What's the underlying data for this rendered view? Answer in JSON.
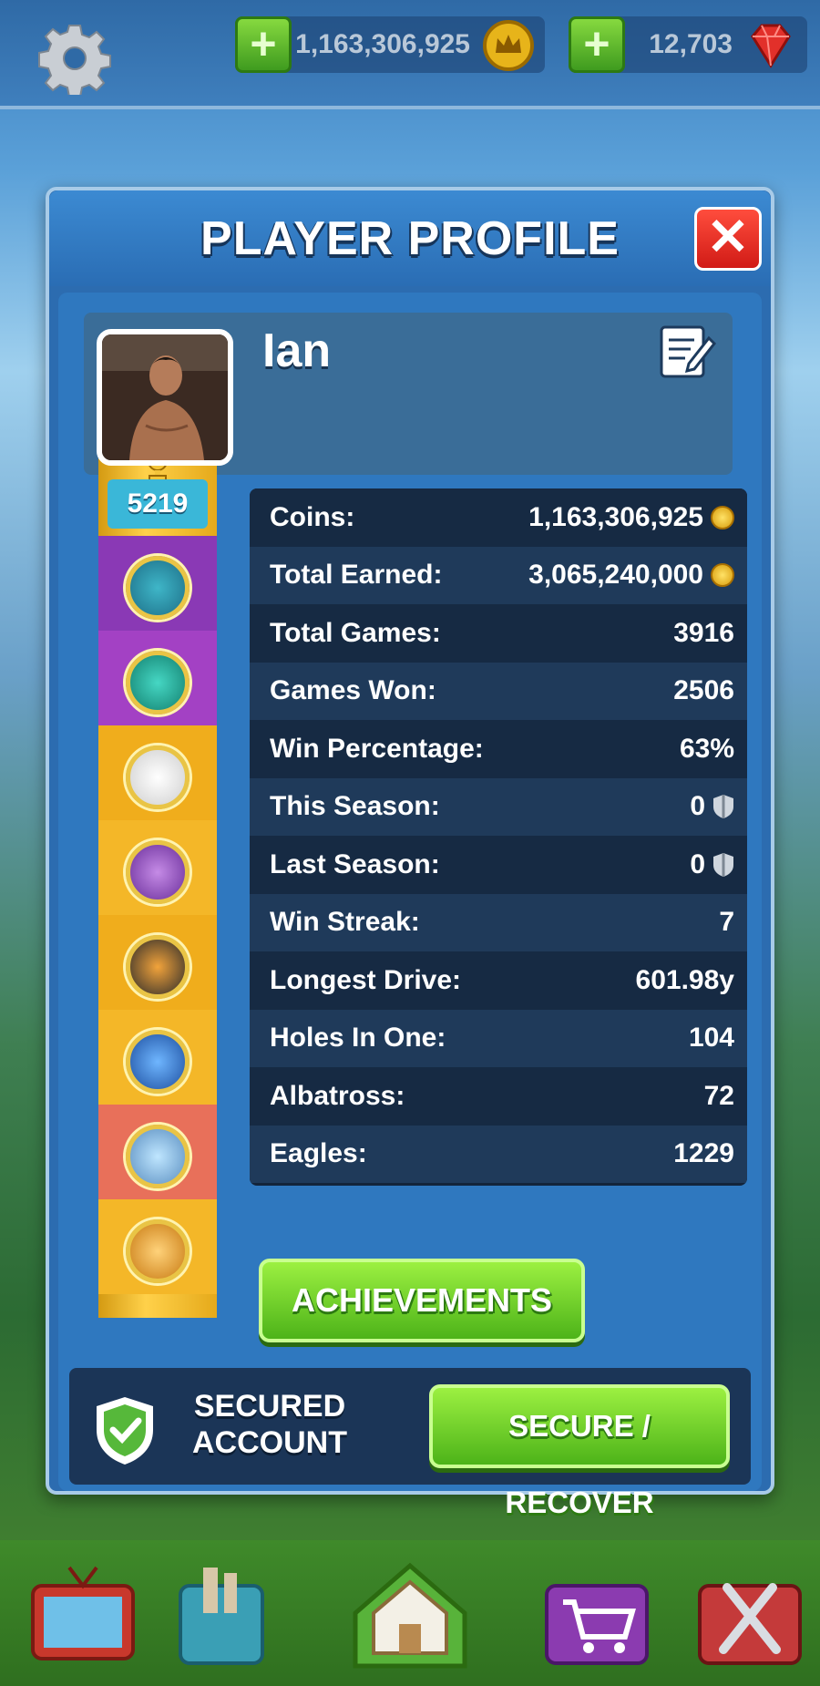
{
  "topbar": {
    "coins": "1,163,306,925",
    "gems": "12,703",
    "plus_label": "+"
  },
  "modal": {
    "title": "PLAYER PROFILE",
    "close_label": "✕"
  },
  "profile": {
    "name": "Ian",
    "trophies": "5219"
  },
  "stats": [
    {
      "label": "Coins:",
      "value": "1,163,306,925",
      "icon": "coin-icon"
    },
    {
      "label": "Total Earned:",
      "value": "3,065,240,000",
      "icon": "coin-icon"
    },
    {
      "label": "Total Games:",
      "value": "3916"
    },
    {
      "label": "Games Won:",
      "value": "2506"
    },
    {
      "label": "Win Percentage:",
      "value": "63%"
    },
    {
      "label": "This Season:",
      "value": "0",
      "icon": "league-shield-icon"
    },
    {
      "label": "Last Season:",
      "value": "0",
      "icon": "league-shield-icon"
    },
    {
      "label": "Win Streak:",
      "value": "7"
    },
    {
      "label": "Longest Drive:",
      "value": "601.98y"
    },
    {
      "label": "Holes In One:",
      "value": "104"
    },
    {
      "label": "Albatross:",
      "value": "72"
    },
    {
      "label": "Eagles:",
      "value": "1229"
    }
  ],
  "buttons": {
    "achievements": "ACHIEVEMENTS",
    "secure_recover": "SECURE / RECOVER"
  },
  "secure": {
    "status_line1": "SECURED",
    "status_line2": "ACCOUNT"
  },
  "colors": {
    "accent_green": "#4db319",
    "panel_blue": "#2f78bf",
    "close_red": "#d11b16"
  }
}
